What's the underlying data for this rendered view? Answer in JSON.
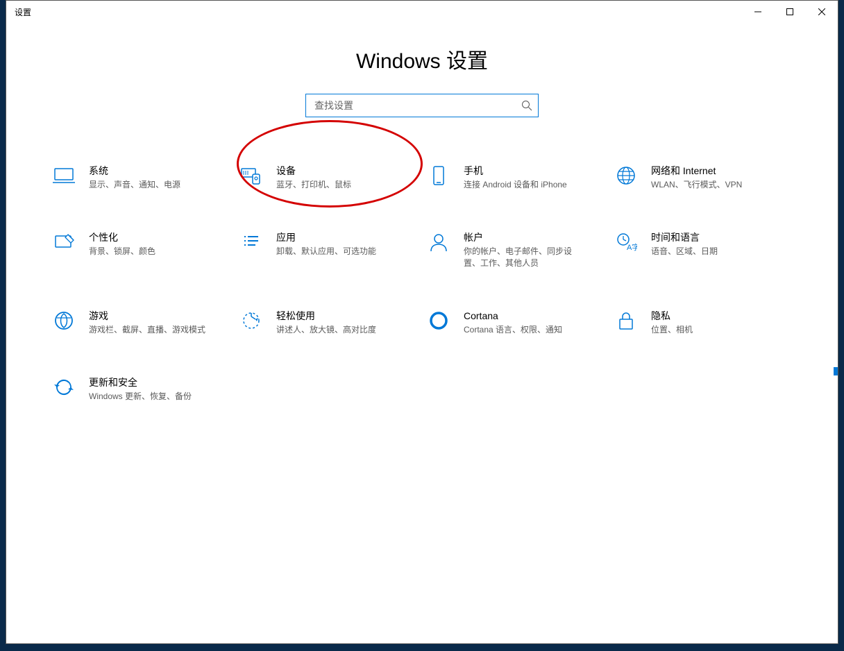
{
  "window": {
    "title": "设置"
  },
  "page": {
    "heading": "Windows 设置"
  },
  "search": {
    "placeholder": "查找设置"
  },
  "tiles": [
    {
      "key": "system",
      "title": "系统",
      "desc": "显示、声音、通知、电源"
    },
    {
      "key": "devices",
      "title": "设备",
      "desc": "蓝牙、打印机、鼠标"
    },
    {
      "key": "phone",
      "title": "手机",
      "desc": "连接 Android 设备和 iPhone"
    },
    {
      "key": "network",
      "title": "网络和 Internet",
      "desc": "WLAN、飞行模式、VPN"
    },
    {
      "key": "personalize",
      "title": "个性化",
      "desc": "背景、锁屏、颜色"
    },
    {
      "key": "apps",
      "title": "应用",
      "desc": "卸载、默认应用、可选功能"
    },
    {
      "key": "accounts",
      "title": "帐户",
      "desc": "你的帐户、电子邮件、同步设置、工作、其他人员"
    },
    {
      "key": "time",
      "title": "时间和语言",
      "desc": "语音、区域、日期"
    },
    {
      "key": "gaming",
      "title": "游戏",
      "desc": "游戏栏、截屏、直播、游戏模式"
    },
    {
      "key": "ease",
      "title": "轻松使用",
      "desc": "讲述人、放大镜、高对比度"
    },
    {
      "key": "cortana",
      "title": "Cortana",
      "desc": "Cortana 语言、权限、通知"
    },
    {
      "key": "privacy",
      "title": "隐私",
      "desc": "位置、相机"
    },
    {
      "key": "update",
      "title": "更新和安全",
      "desc": "Windows 更新、恢复、备份"
    }
  ],
  "annotation": {
    "target_tile": "devices"
  },
  "colors": {
    "accent": "#0078d7",
    "annotation": "#d40000"
  }
}
